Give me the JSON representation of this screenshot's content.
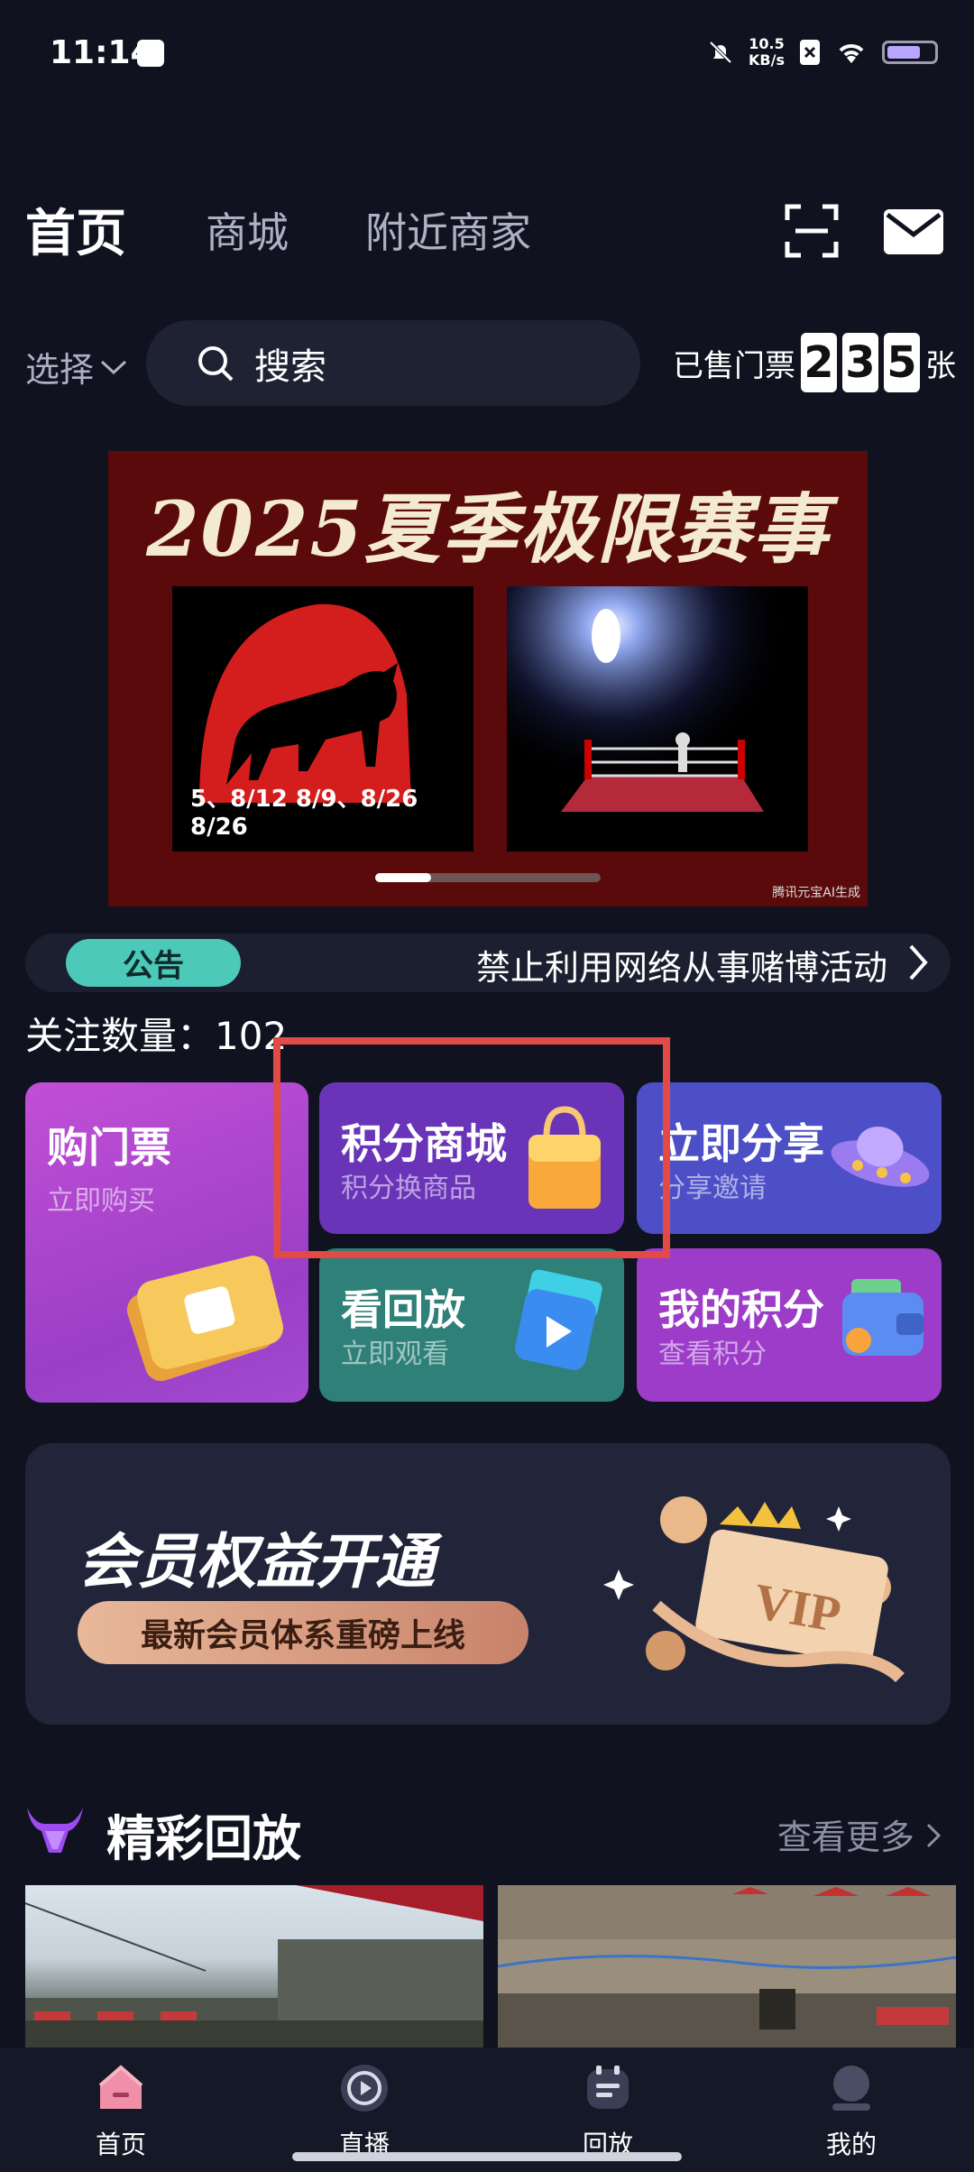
{
  "status_bar": {
    "time": "11:14",
    "speed_value": "10.5",
    "speed_unit": "KB/s"
  },
  "header": {
    "tabs": [
      "首页",
      "商城",
      "附近商家"
    ]
  },
  "search": {
    "select_label": "选择",
    "placeholder": "搜索"
  },
  "tickets_sold": {
    "prefix": "已售门票",
    "digits": [
      "2",
      "3",
      "5"
    ],
    "suffix": "张"
  },
  "banner": {
    "title": "2025夏季极限赛事",
    "dates": "5、8/12 8/9、8/26 8/26",
    "credit": "腾讯元宝AI生成"
  },
  "notice": {
    "tag": "公告",
    "text": "禁止利用网络从事赌博活动"
  },
  "follow": {
    "label": "关注数量：",
    "count": "102"
  },
  "features": {
    "tickets": {
      "title": "购门票",
      "subtitle": "立即购买"
    },
    "points_mall": {
      "title": "积分商城",
      "subtitle": "积分换商品"
    },
    "share": {
      "title": "立即分享",
      "subtitle": "分享邀请"
    },
    "replay": {
      "title": "看回放",
      "subtitle": "立即观看"
    },
    "my_points": {
      "title": "我的积分",
      "subtitle": "查看积分"
    }
  },
  "vip": {
    "title": "会员权益开通",
    "button": "最新会员体系重磅上线",
    "badge": "VIP"
  },
  "highlights": {
    "title": "精彩回放",
    "more": "查看更多"
  },
  "bottom_nav": [
    "首页",
    "直播",
    "回放",
    "我的"
  ],
  "colors": {
    "background": "#10131f",
    "accent_red": "#e24a45",
    "notice_tag": "#4cc9b8"
  }
}
